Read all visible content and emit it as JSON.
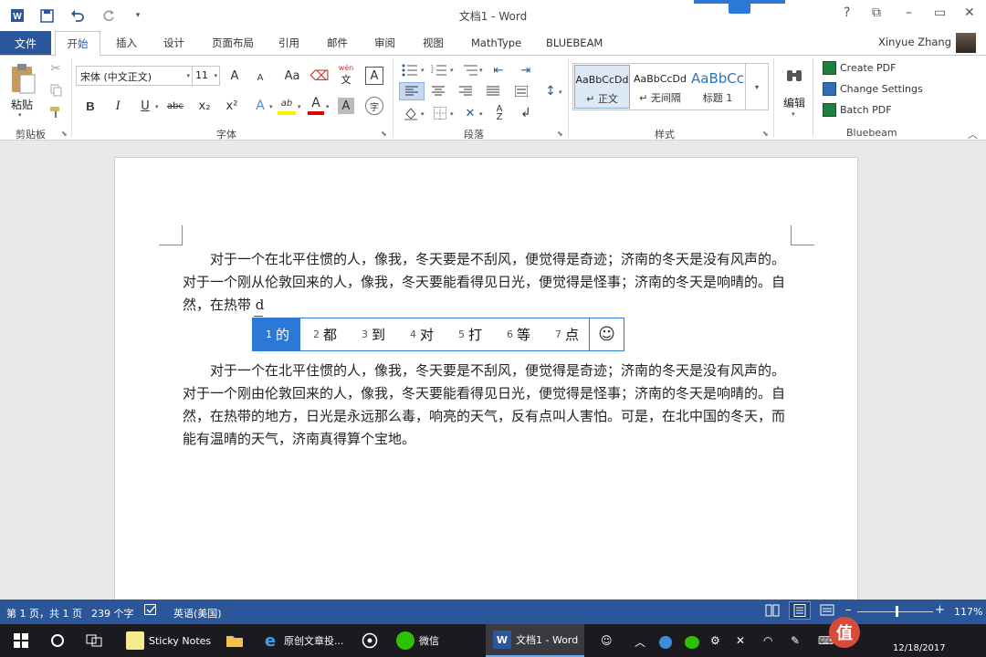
{
  "app": {
    "title": "文档1 - Word",
    "user": "Xinyue Zhang"
  },
  "titlebar": {
    "help": "?",
    "restore_ribbon": "⧉",
    "minimize": "–",
    "maximize": "▭",
    "close": "✕"
  },
  "quick_access": {
    "save": "save-icon",
    "undo": "undo-icon",
    "redo": "redo-icon",
    "customize": "▾"
  },
  "tabs": {
    "file": "文件",
    "items": [
      "开始",
      "插入",
      "设计",
      "页面布局",
      "引用",
      "邮件",
      "审阅",
      "视图",
      "MathType",
      "BLUEBEAM"
    ]
  },
  "ribbon": {
    "clipboard": {
      "paste": "粘贴",
      "group": "剪贴板"
    },
    "font": {
      "name": "宋体 (中文正文)",
      "size": "11",
      "group": "字体",
      "grow": "A",
      "shrink": "A",
      "case": "Aa",
      "wen": "wén",
      "wen2": "文",
      "border_a": "A",
      "bold": "B",
      "italic": "I",
      "underline": "U",
      "strike": "abc",
      "sub": "x₂",
      "sup": "x²",
      "effects": "A",
      "highlight": "ab",
      "color": "A",
      "shading": "A",
      "enclose": "字"
    },
    "paragraph": {
      "group": "段落"
    },
    "styles": {
      "group": "样式",
      "items": [
        {
          "sample": "AaBbCcDd",
          "label": "↵ 正文"
        },
        {
          "sample": "AaBbCcDd",
          "label": "↵ 无间隔"
        },
        {
          "sample": "AaBbCc",
          "label": "标题 1"
        }
      ]
    },
    "editing": {
      "label": "编辑"
    },
    "bluebeam": {
      "group": "Bluebeam",
      "buttons": [
        "Create PDF",
        "Change Settings",
        "Batch PDF"
      ]
    }
  },
  "document": {
    "para1": "对于一个在北平住惯的人，像我，冬天要是不刮风，便觉得是奇迹；济南的冬天是没有风声的。对于一个刚从伦敦回来的人，像我，冬天要能看得见日光，便觉得是怪事；济南的冬天是响晴的。自然，在热带 d",
    "para2": "对于一个在北平住惯的人，像我，冬天要是不刮风，便觉得是奇迹；济南的冬天是没有风声的。对于一个刚由伦敦回来的人，像我，冬天要能看得见日光，便觉得是怪事；济南的冬天是响晴的。自然，在热带的地方，日光是永远那么毒，响亮的天气，反有点叫人害怕。可是，在北中国的冬天，而能有温晴的天气，济南真得算个宝地。"
  },
  "ime": {
    "candidates": [
      {
        "n": "1",
        "t": "的"
      },
      {
        "n": "2",
        "t": "都"
      },
      {
        "n": "3",
        "t": "到"
      },
      {
        "n": "4",
        "t": "对"
      },
      {
        "n": "5",
        "t": "打"
      },
      {
        "n": "6",
        "t": "等"
      },
      {
        "n": "7",
        "t": "点"
      }
    ],
    "emoji": "☺"
  },
  "status": {
    "page": "第 1 页，共 1 页",
    "words": "239 个字",
    "lang": "英语(美国)",
    "zoom": "117%",
    "zoom_level": 1.17
  },
  "taskbar": {
    "sticky": "Sticky Notes",
    "browser": "原创文章投...",
    "wechat": "微信",
    "word": "文档1 - Word",
    "date": "12/18/2017",
    "lang": "M"
  },
  "colors": {
    "accent": "#2b579a",
    "ime_blue": "#2b78d6"
  }
}
